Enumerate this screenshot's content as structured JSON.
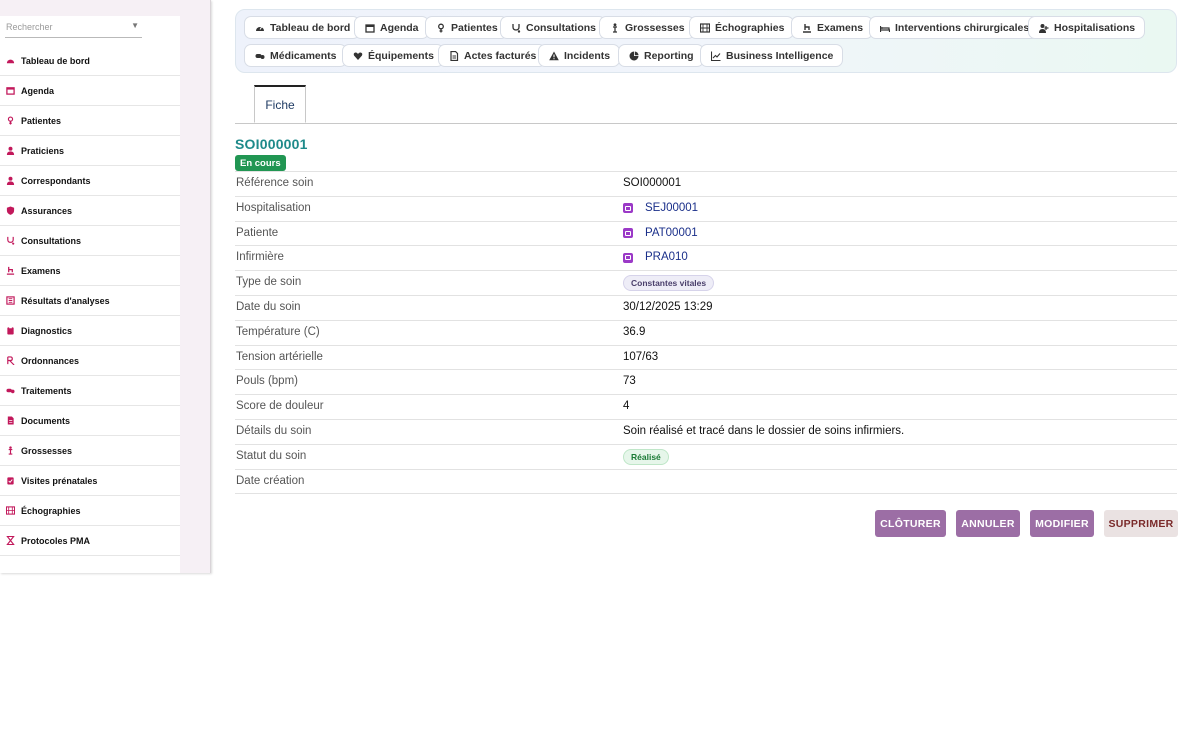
{
  "search": {
    "placeholder": "Rechercher"
  },
  "sidebar": {
    "items": [
      {
        "label": "Tableau de bord",
        "icon": "dashboard-icon"
      },
      {
        "label": "Agenda",
        "icon": "calendar-icon"
      },
      {
        "label": "Patientes",
        "icon": "female-icon"
      },
      {
        "label": "Praticiens",
        "icon": "user-md-icon"
      },
      {
        "label": "Correspondants",
        "icon": "user-icon"
      },
      {
        "label": "Assurances",
        "icon": "shield-icon"
      },
      {
        "label": "Consultations",
        "icon": "stethoscope-icon"
      },
      {
        "label": "Examens",
        "icon": "exam-icon"
      },
      {
        "label": "Résultats d'analyses",
        "icon": "lab-icon"
      },
      {
        "label": "Diagnostics",
        "icon": "clipboard-icon"
      },
      {
        "label": "Ordonnances",
        "icon": "prescription-icon"
      },
      {
        "label": "Traitements",
        "icon": "pills-icon"
      },
      {
        "label": "Documents",
        "icon": "document-icon"
      },
      {
        "label": "Grossesses",
        "icon": "pregnancy-icon"
      },
      {
        "label": "Visites prénatales",
        "icon": "clipboard-check-icon"
      },
      {
        "label": "Échographies",
        "icon": "ultrasound-icon"
      },
      {
        "label": "Protocoles PMA",
        "icon": "hourglass-icon"
      }
    ]
  },
  "topnav": {
    "items": [
      {
        "label": "Tableau de bord",
        "icon": "dashboard-icon"
      },
      {
        "label": "Agenda",
        "icon": "calendar-icon"
      },
      {
        "label": "Patientes",
        "icon": "female-icon"
      },
      {
        "label": "Consultations",
        "icon": "stethoscope-icon"
      },
      {
        "label": "Grossesses",
        "icon": "pregnancy-icon"
      },
      {
        "label": "Échographies",
        "icon": "ultrasound-icon"
      },
      {
        "label": "Examens",
        "icon": "exam-icon"
      },
      {
        "label": "Interventions chirurgicales",
        "icon": "surgery-bed-icon"
      },
      {
        "label": "Hospitalisations",
        "icon": "hospital-icon"
      },
      {
        "label": "Médicaments",
        "icon": "pills-icon"
      },
      {
        "label": "Équipements",
        "icon": "equipment-icon"
      },
      {
        "label": "Actes facturés",
        "icon": "invoice-icon"
      },
      {
        "label": "Incidents",
        "icon": "warning-icon"
      },
      {
        "label": "Reporting",
        "icon": "pie-chart-icon"
      },
      {
        "label": "Business Intelligence",
        "icon": "line-chart-icon"
      }
    ]
  },
  "tabs": {
    "fiche": "Fiche"
  },
  "record": {
    "title": "SOI000001",
    "status": "En cours",
    "fields": [
      {
        "label": "Référence soin",
        "value": "SOI000001"
      },
      {
        "label": "Hospitalisation",
        "value": "SEJ00001"
      },
      {
        "label": "Patiente",
        "value": "PAT00001"
      },
      {
        "label": "Infirmière",
        "value": "PRA010"
      },
      {
        "label": "Type de soin",
        "value": "Constantes vitales"
      },
      {
        "label": "Date du soin",
        "value": "30/12/2025 13:29"
      },
      {
        "label": "Température (C)",
        "value": "36.9"
      },
      {
        "label": "Tension artérielle",
        "value": "107/63"
      },
      {
        "label": "Pouls (bpm)",
        "value": "73"
      },
      {
        "label": "Score de douleur",
        "value": "4"
      },
      {
        "label": "Détails du soin",
        "value": "Soin réalisé et tracé dans le dossier de soins infirmiers."
      },
      {
        "label": "Statut du soin",
        "value": "Réalisé"
      },
      {
        "label": "Date création",
        "value": ""
      }
    ]
  },
  "actions": {
    "close": "CLÔTURER",
    "cancel": "ANNULER",
    "edit": "MODIFIER",
    "delete": "SUPPRIMER"
  },
  "colors": {
    "accent_purple": "#9c6ea5",
    "title_teal": "#1e8a8a",
    "status_green": "#219653",
    "sidebar_icon": "#c2185b",
    "link_blue": "#1a2f8a"
  }
}
